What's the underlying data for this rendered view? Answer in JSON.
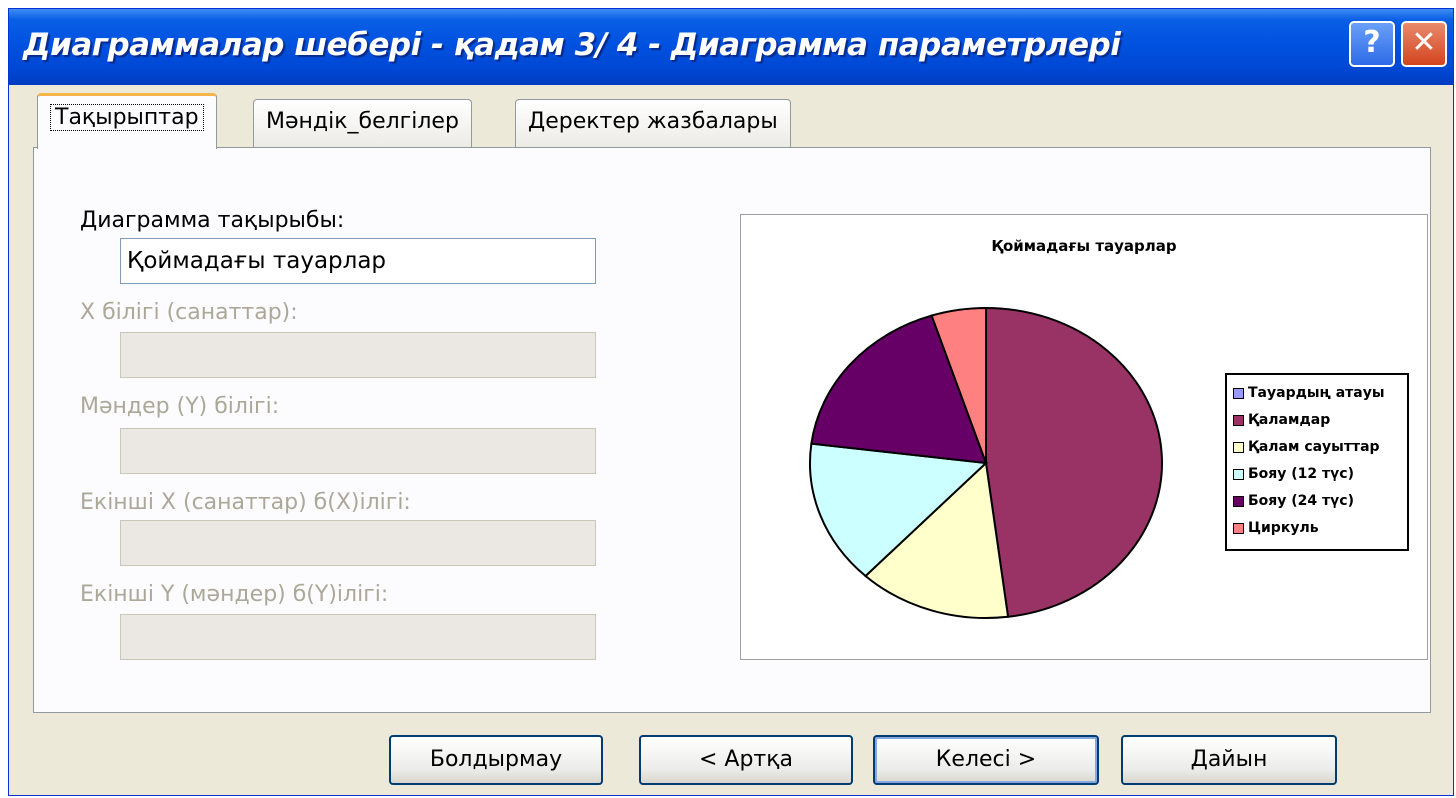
{
  "window": {
    "title": "Диаграммалар шебері - қадам 3/ 4 - Диаграмма параметрлері",
    "help_label": "?",
    "close_label": "✕"
  },
  "tabs": [
    {
      "label": "Тақырыптар"
    },
    {
      "label": "Мәндік_белгілер"
    },
    {
      "label": "Деректер жазбалары"
    }
  ],
  "form": {
    "chart_title_label": "Диаграмма тақырыбы:",
    "chart_title_value": "Қоймадағы тауарлар",
    "x_axis_label": "X білігі (санаттар):",
    "y_axis_label": "Мәндер (Y) білігі:",
    "second_x_label": "Екінші X (санаттар) б(X)ілігі:",
    "second_y_label": "Екінші Y (мәндер) б(Y)ілігі:"
  },
  "buttons": {
    "cancel": "Болдырмау",
    "back": "< Артқа",
    "next": "Келесі >",
    "finish": "Дайын"
  },
  "chart_data": {
    "type": "pie",
    "title": "Қоймадағы тауарлар",
    "categories": [
      "Тауардың атауы",
      "Қаламдар",
      "Қалам сауыттар",
      "Бояу (12 түс)",
      "Бояу (24 түс)",
      "Циркуль"
    ],
    "values": [
      0,
      48,
      14,
      15,
      18,
      5
    ],
    "colors": [
      "#9999ff",
      "#993366",
      "#ffffcc",
      "#ccffff",
      "#660066",
      "#ff8080"
    ],
    "legend_position": "right"
  }
}
